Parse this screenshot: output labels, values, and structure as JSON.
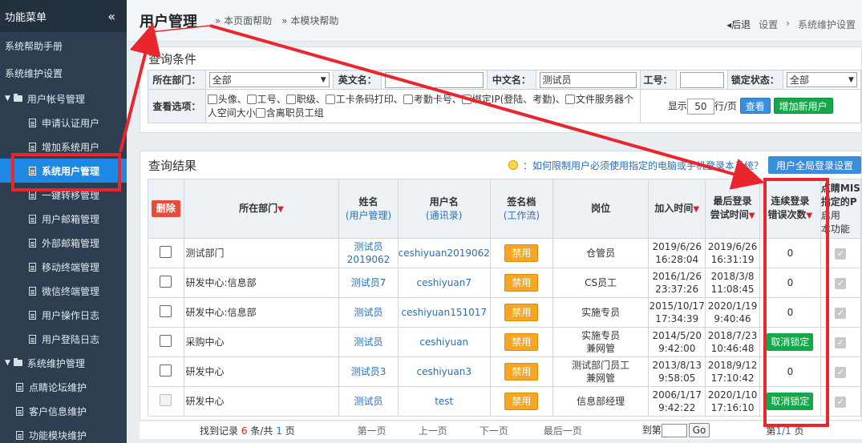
{
  "sidebar": {
    "header": "功能菜单",
    "collapse_glyph": "«",
    "items": [
      {
        "label": "系统帮助手册",
        "kind": "top"
      },
      {
        "label": "系统维护设置",
        "kind": "top"
      },
      {
        "label": "用户帐号管理",
        "kind": "group"
      },
      {
        "label": "申请认证用户",
        "kind": "sub"
      },
      {
        "label": "增加系统用户",
        "kind": "sub"
      },
      {
        "label": "系统用户管理",
        "kind": "sub",
        "active": true
      },
      {
        "label": "一键转移管理",
        "kind": "sub"
      },
      {
        "label": "用户邮箱管理",
        "kind": "sub"
      },
      {
        "label": "外部邮箱管理",
        "kind": "sub"
      },
      {
        "label": "移动终端管理",
        "kind": "sub"
      },
      {
        "label": "微信终端管理",
        "kind": "sub"
      },
      {
        "label": "用户操作日志",
        "kind": "sub"
      },
      {
        "label": "用户登陆日志",
        "kind": "sub"
      },
      {
        "label": "系统维护管理",
        "kind": "group"
      },
      {
        "label": "点睛论坛维护",
        "kind": "sub2"
      },
      {
        "label": "客户信息维护",
        "kind": "sub2"
      },
      {
        "label": "功能模块维护",
        "kind": "sub2"
      }
    ]
  },
  "header": {
    "title": "用户管理",
    "help_page": "» 本页面帮助",
    "help_module": "» 本模块帮助",
    "back": "◂后退",
    "crumb1": "设置",
    "crumb_sep": "›",
    "crumb2": "系统维护设置"
  },
  "query": {
    "title": "查询条件",
    "dept_label": "所在部门：",
    "dept_value": "全部",
    "en_label": "英文名：",
    "en_value": "",
    "cn_label": "中文名：",
    "cn_value": "测试员",
    "id_label": "工号：",
    "id_value": "",
    "lock_label": "锁定状态：",
    "lock_value": "全部",
    "options_label": "查看选项：",
    "options": [
      "头像、",
      "工号、",
      "职级、",
      "工卡条码打印、",
      "考勤卡号、",
      "绑定IP(登陆、考勤)、",
      "文件服务器个人空间大小",
      "含离职员工组"
    ],
    "show_prefix": "显示",
    "show_value": "50",
    "show_suffix": "行/页",
    "search_btn": "查看",
    "add_btn": "增加新用户"
  },
  "results": {
    "title": "查询结果",
    "tip": "：如何限制用户必须使用指定的电脑或手机登录本系统？",
    "global_btn": "用户全局登录设置",
    "columns": {
      "delete": "删除",
      "dept": "所在部门",
      "name": "姓名",
      "name_sub": "(用户管理)",
      "user": "用户名",
      "user_sub": "(通讯录)",
      "sign": "签名档",
      "sign_sub": "(工作流)",
      "post": "岗位",
      "join": "加入时间",
      "last1": "最后登录",
      "last2": "尝试时间",
      "err1": "连续登录",
      "err2": "错误次数",
      "mis1": "点睛MIS",
      "mis2": "指定的P",
      "enable1": "启用",
      "enable2": "本功能",
      "sort_glyph": "▼"
    },
    "ban_label": "禁用",
    "unlock_label": "取消锁定",
    "rows": [
      {
        "dept": "测试部门",
        "name1": "测试员",
        "name2": "2019062",
        "user": "ceshiyuan2019062",
        "post1": "仓管员",
        "post2": "",
        "join1": "2019/6/26",
        "join2": "16:28:04",
        "last1": "2019/6/26",
        "last2": "16:31:19",
        "errors": "0",
        "locked": false,
        "disabled": false
      },
      {
        "dept": "研发中心:信息部",
        "name1": "测试员7",
        "name2": "",
        "user": "ceshiyuan7",
        "post1": "CS员工",
        "post2": "",
        "join1": "2016/1/26",
        "join2": "23:37:26",
        "last1": "2018/3/8",
        "last2": "11:08:45",
        "errors": "0",
        "locked": false,
        "disabled": false
      },
      {
        "dept": "研发中心:信息部",
        "name1": "测试员",
        "name2": "",
        "user": "ceshiyuan151017",
        "post1": "实施专员",
        "post2": "",
        "join1": "2015/10/17",
        "join2": "17:34:39",
        "last1": "2020/1/19",
        "last2": "9:40:46",
        "errors": "0",
        "locked": false,
        "disabled": false
      },
      {
        "dept": "采购中心",
        "name1": "测试员",
        "name2": "",
        "user": "ceshiyuan",
        "post1": "实施专员",
        "post2": "兼网管",
        "join1": "2014/5/20",
        "join2": "9:42:00",
        "last1": "2018/7/23",
        "last2": "10:46:48",
        "errors": "",
        "locked": true,
        "disabled": false
      },
      {
        "dept": "研发中心",
        "name1": "测试员3",
        "name2": "",
        "user": "ceshiyuan3",
        "post1": "测试部门员工",
        "post2": "兼网管",
        "join1": "2013/8/13",
        "join2": "9:58:05",
        "last1": "2018/9/12",
        "last2": "17:10:42",
        "errors": "0",
        "locked": false,
        "disabled": false
      },
      {
        "dept": "研发中心",
        "name1": "测试员",
        "name2": "",
        "user": "test",
        "post1": "信息部经理",
        "post2": "",
        "join1": "2006/1/17",
        "join2": "9:42:22",
        "last1": "2020/1/10",
        "last2": "17:16:10",
        "errors": "",
        "locked": true,
        "disabled": true
      }
    ]
  },
  "pager": {
    "found_prefix": "找到记录",
    "found_count": "6",
    "found_mid": "条/共",
    "found_pages": "1",
    "found_suffix": "页",
    "first": "第一页",
    "prev": "上一页",
    "next": "下一页",
    "last": "最后一页",
    "goto_prefix": "到第",
    "goto_suffix": "页",
    "go": "Go",
    "current_prefix": "第",
    "current": "1/1",
    "current_suffix": "页"
  },
  "colors": {
    "annotation": "#e8262c",
    "sidebar_bg": "#2d3e50",
    "active": "#1e88e5",
    "ban": "#f5a623",
    "unlock": "#13a84a"
  }
}
